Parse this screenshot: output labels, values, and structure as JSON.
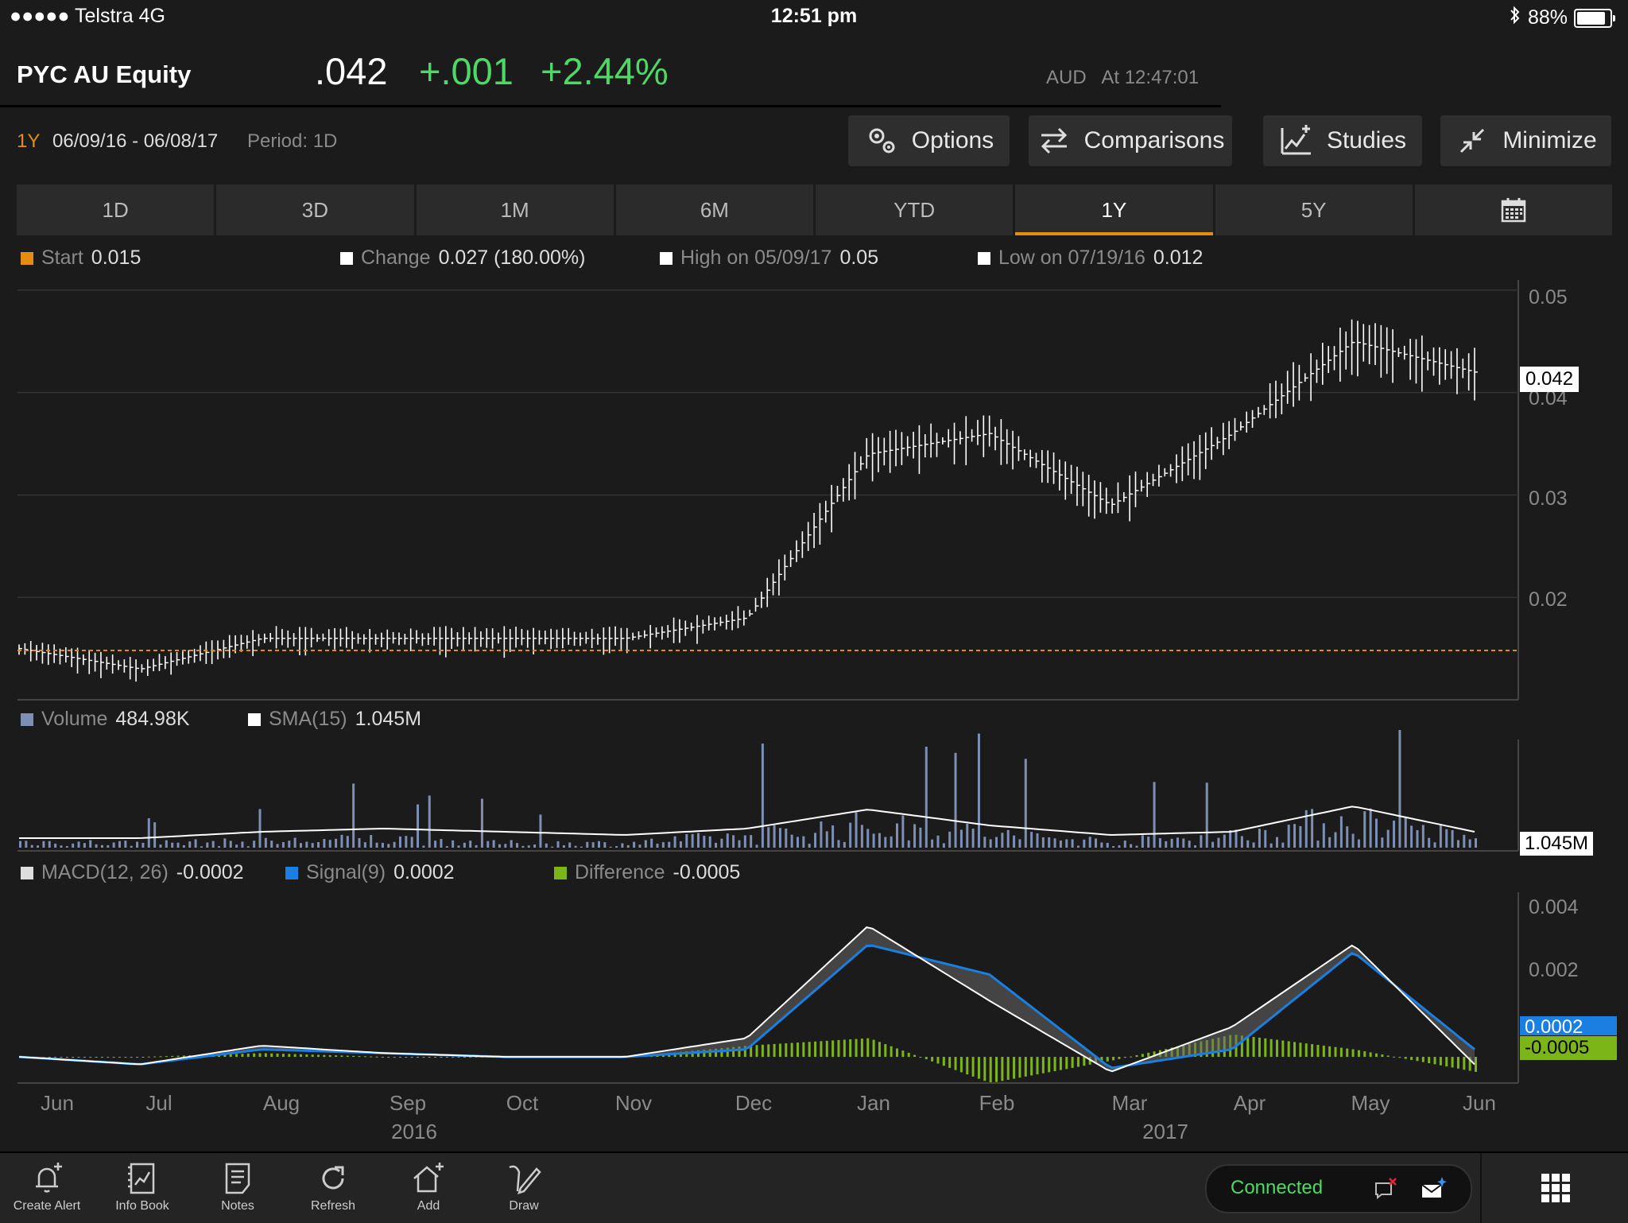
{
  "status_bar": {
    "carrier": "●●●●● Telstra  4G",
    "time": "12:51 pm",
    "battery": "88%",
    "battery_level": 0.88
  },
  "ticker": {
    "symbol": "PYC AU Equity",
    "price": ".042",
    "change": "+.001",
    "change_pct": "+2.44%",
    "currency": "AUD",
    "time": "At 12:47:01"
  },
  "range": {
    "label": "1Y",
    "dates": "06/09/16 - 06/08/17",
    "period": "Period: 1D"
  },
  "buttons": {
    "options": "Options",
    "comparisons": "Comparisons",
    "studies": "Studies",
    "minimize": "Minimize"
  },
  "tabs": [
    "1D",
    "3D",
    "1M",
    "6M",
    "YTD",
    "1Y",
    "5Y"
  ],
  "active_tab": "1Y",
  "price_legend": {
    "start_name": "Start",
    "start_val": "0.015",
    "change_name": "Change",
    "change_val": "0.027 (180.00%)",
    "high_name": "High on 05/09/17",
    "high_val": "0.05",
    "low_name": "Low on 07/19/16",
    "low_val": "0.012"
  },
  "volume_legend": {
    "volume_name": "Volume",
    "volume_val": "484.98K",
    "sma_name": "SMA(15)",
    "sma_val": "1.045M"
  },
  "macd_legend": {
    "macd_name": "MACD(12, 26)",
    "macd_val": "-0.0002",
    "signal_name": "Signal(9)",
    "signal_val": "0.0002",
    "diff_name": "Difference",
    "diff_val": "-0.0005"
  },
  "tags": {
    "price": "0.042",
    "volume": "1.045M",
    "signal": "0.0002",
    "diff": "-0.0005"
  },
  "colors": {
    "orange": "#e58d13",
    "green": "#4cd964",
    "volume": "#7d8fb5",
    "signal": "#1a7fe0",
    "diff": "#7cb518"
  },
  "chart_data": [
    {
      "type": "bar",
      "title": "PYC AU Equity",
      "x": [
        "2016-06",
        "2016-07",
        "2016-08",
        "2016-09",
        "2016-10",
        "2016-11",
        "2016-12",
        "2017-01",
        "2017-02",
        "2017-03",
        "2017-04",
        "2017-05",
        "2017-06"
      ],
      "xticks": [
        "Jun",
        "Jul",
        "Aug",
        "Sep",
        "Oct",
        "Nov",
        "Dec",
        "Jan",
        "Feb",
        "Mar",
        "Apr",
        "May",
        "Jun"
      ],
      "year_labels": [
        "2016",
        "2017"
      ],
      "series": [
        {
          "values": [
            0.015,
            0.013,
            0.016,
            0.016,
            0.016,
            0.016,
            0.018,
            0.034,
            0.036,
            0.029,
            0.036,
            0.045,
            0.042
          ]
        }
      ],
      "start_line": 0.015,
      "ylim": [
        0.01,
        0.051
      ],
      "yticks": [
        "0.05",
        "0.04",
        "0.03",
        "0.02"
      ],
      "ytick_values": [
        0.05,
        0.04,
        0.03,
        0.02
      ]
    },
    {
      "type": "bar",
      "series": [
        {
          "name": "Volume",
          "values": [
            0.4,
            0.3,
            0.4,
            0.6,
            0.3,
            0.3,
            0.8,
            1.5,
            0.9,
            0.4,
            0.8,
            2.0,
            0.5
          ]
        },
        {
          "name": "SMA(15)",
          "values": [
            0.3,
            0.3,
            0.5,
            0.6,
            0.5,
            0.4,
            0.6,
            1.2,
            0.7,
            0.4,
            0.5,
            1.3,
            0.5
          ]
        }
      ]
    },
    {
      "type": "line",
      "series": [
        {
          "name": "MACD(12, 26)",
          "values": [
            0.0,
            -0.0002,
            0.0003,
            0.0001,
            0.0,
            0.0,
            0.0005,
            0.0035,
            0.0015,
            -0.0004,
            0.0008,
            0.003,
            -0.0002
          ]
        },
        {
          "name": "Signal(9)",
          "values": [
            0.0,
            -0.0002,
            0.0002,
            0.0001,
            0.0,
            0.0,
            0.0002,
            0.003,
            0.0022,
            -0.0003,
            0.0002,
            0.0028,
            0.0002
          ]
        }
      ],
      "ylim": [
        -0.0007,
        0.0044
      ],
      "yticks": [
        "0.004",
        "0.002"
      ],
      "ytick_values": [
        0.004,
        0.002
      ]
    }
  ],
  "toolbar": {
    "create_alert": "Create Alert",
    "info_book": "Info Book",
    "notes": "Notes",
    "refresh": "Refresh",
    "add": "Add",
    "draw": "Draw",
    "connection": "Connected"
  }
}
